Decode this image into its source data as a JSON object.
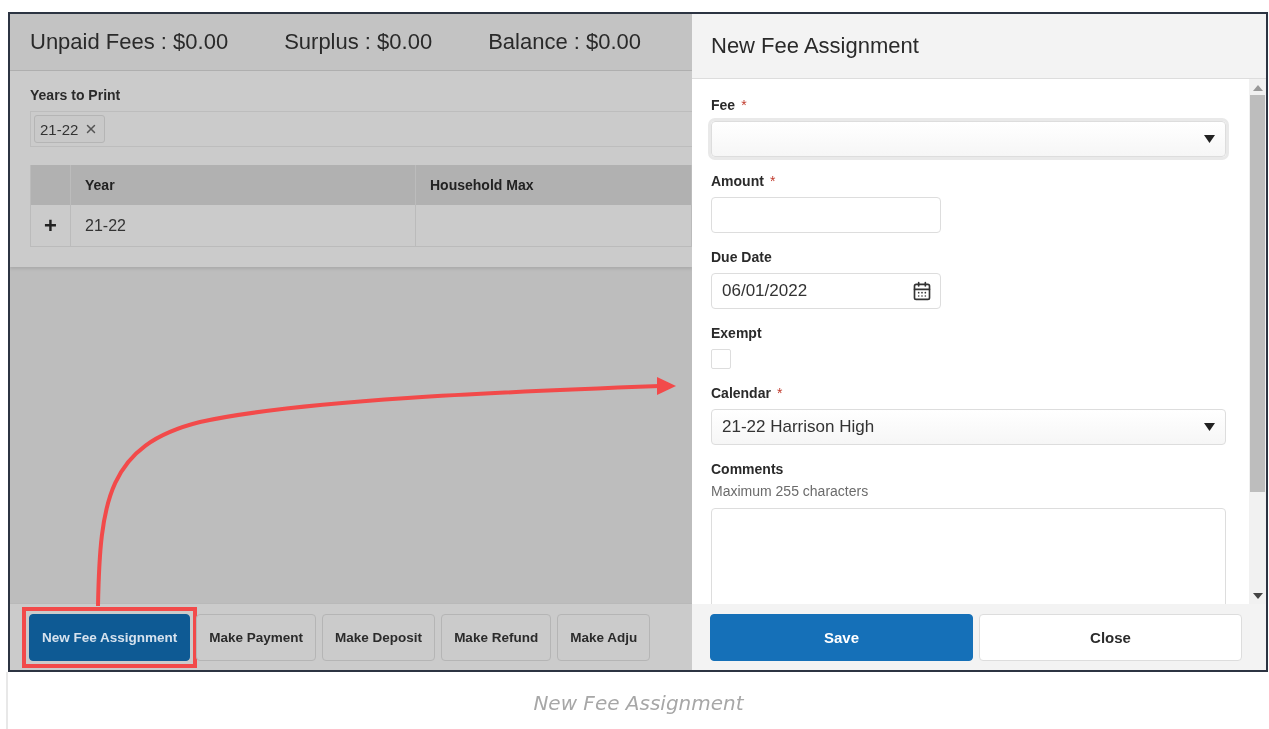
{
  "summary": [
    {
      "text": "Unpaid Fees : $0.00"
    },
    {
      "text": "Surplus : $0.00"
    },
    {
      "text": "Balance : $0.00"
    }
  ],
  "years_to_print": {
    "label": "Years to Print",
    "chips": [
      "21-22"
    ]
  },
  "table": {
    "columns": [
      "Year",
      "Household Max"
    ],
    "rows": [
      {
        "toggle": "+",
        "year": "21-22"
      }
    ]
  },
  "actions": [
    {
      "label": "New Fee Assignment",
      "kind": "primary",
      "highlighted": true
    },
    {
      "label": "Make Payment",
      "kind": "secondary",
      "highlighted": false
    },
    {
      "label": "Make Deposit",
      "kind": "secondary",
      "highlighted": false
    },
    {
      "label": "Make Refund",
      "kind": "secondary",
      "highlighted": false
    },
    {
      "label": "Make Adju",
      "kind": "secondary",
      "highlighted": false
    }
  ],
  "panel": {
    "title": "New Fee Assignment",
    "fields": [
      {
        "kind": "select",
        "label": "Fee",
        "required_mark": "*",
        "focused": true
      },
      {
        "kind": "text",
        "label": "Amount",
        "required_mark": "*"
      },
      {
        "kind": "date",
        "label": "Due Date",
        "value": "06/01/2022"
      },
      {
        "kind": "checkbox",
        "label": "Exempt",
        "checked": false
      },
      {
        "kind": "select",
        "label": "Calendar",
        "required_mark": "*",
        "focused": false,
        "value": "21-22 Harrison High"
      },
      {
        "kind": "textarea",
        "label": "Comments",
        "hint": "Maximum 255 characters"
      }
    ],
    "buttons": [
      {
        "label": "Save",
        "kind": "primary"
      },
      {
        "label": "Close",
        "kind": "secondary"
      }
    ]
  },
  "caption": "New Fee Assignment"
}
